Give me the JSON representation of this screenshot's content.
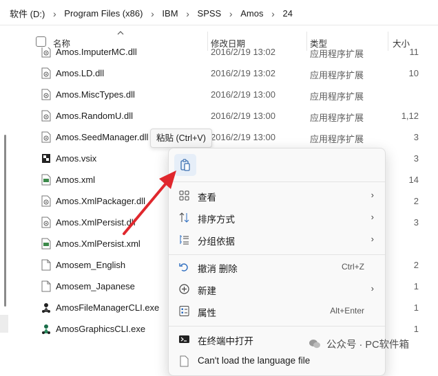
{
  "breadcrumb": {
    "items": [
      "软件 (D:)",
      "Program Files (x86)",
      "IBM",
      "SPSS",
      "Amos",
      "24"
    ],
    "separator": "›"
  },
  "columns": {
    "name": "名称",
    "date": "修改日期",
    "type": "类型",
    "size": "大小",
    "sort_indicator": "^"
  },
  "files": [
    {
      "name": "Amos.ImputerMC.dll",
      "date": "2016/2/19 13:02",
      "type": "应用程序扩展",
      "size": "11",
      "icon": "dll-file-icon"
    },
    {
      "name": "Amos.LD.dll",
      "date": "2016/2/19 13:02",
      "type": "应用程序扩展",
      "size": "10",
      "icon": "dll-file-icon"
    },
    {
      "name": "Amos.MiscTypes.dll",
      "date": "2016/2/19 13:00",
      "type": "应用程序扩展",
      "size": "",
      "icon": "dll-file-icon"
    },
    {
      "name": "Amos.RandomU.dll",
      "date": "2016/2/19 13:00",
      "type": "应用程序扩展",
      "size": "1,12",
      "icon": "dll-file-icon"
    },
    {
      "name": "Amos.SeedManager.dll",
      "date": "2016/2/19 13:00",
      "type": "应用程序扩展",
      "size": "3",
      "icon": "dll-file-icon"
    },
    {
      "name": "Amos.vsix",
      "date": "",
      "type": "",
      "size": "3",
      "icon": "vsix-file-icon"
    },
    {
      "name": "Amos.xml",
      "date": "",
      "type": "",
      "size": "14",
      "icon": "xml-file-icon"
    },
    {
      "name": "Amos.XmlPackager.dll",
      "date": "",
      "type": "",
      "size": "2",
      "icon": "dll-file-icon"
    },
    {
      "name": "Amos.XmlPersist.dll",
      "date": "",
      "type": "",
      "size": "3",
      "icon": "dll-file-icon"
    },
    {
      "name": "Amos.XmlPersist.xml",
      "date": "",
      "type": "",
      "size": "",
      "icon": "xml-file-icon"
    },
    {
      "name": "Amosem_English",
      "date": "",
      "type": "",
      "size": "2",
      "icon": "blank-file-icon"
    },
    {
      "name": "Amosem_Japanese",
      "date": "",
      "type": "",
      "size": "1",
      "icon": "blank-file-icon"
    },
    {
      "name": "AmosFileManagerCLI.exe",
      "date": "",
      "type": "",
      "size": "1",
      "icon": "exe-file-icon"
    },
    {
      "name": "AmosGraphicsCLI.exe",
      "date": "",
      "type": "",
      "size": "1",
      "icon": "exe-file-icon"
    }
  ],
  "tooltip": "粘贴 (Ctrl+V)",
  "context_menu": {
    "paste_icon": "paste-icon",
    "items": [
      {
        "label": "查看",
        "icon": "grid-view-icon",
        "shortcut": "",
        "submenu": true
      },
      {
        "label": "排序方式",
        "icon": "sort-icon",
        "shortcut": "",
        "submenu": true
      },
      {
        "label": "分组依据",
        "icon": "group-icon",
        "shortcut": "",
        "submenu": true
      },
      {
        "label": "撤消 删除",
        "icon": "undo-icon",
        "shortcut": "Ctrl+Z",
        "submenu": false
      },
      {
        "label": "新建",
        "icon": "new-icon",
        "shortcut": "",
        "submenu": true
      },
      {
        "label": "属性",
        "icon": "properties-icon",
        "shortcut": "Alt+Enter",
        "submenu": false
      },
      {
        "label": "在终端中打开",
        "icon": "terminal-icon",
        "shortcut": "",
        "submenu": false
      },
      {
        "label": "Can't load the language file",
        "icon": "file-icon",
        "shortcut": "",
        "submenu": false
      }
    ],
    "submenu_chevron": "›"
  },
  "watermark": "公众号 · PC软件箱",
  "colors": {
    "accent": "#0067c0",
    "arrow": "#e0272d",
    "menu_bg": "#f9f9f9",
    "paste_highlight": "#e6eef8"
  }
}
